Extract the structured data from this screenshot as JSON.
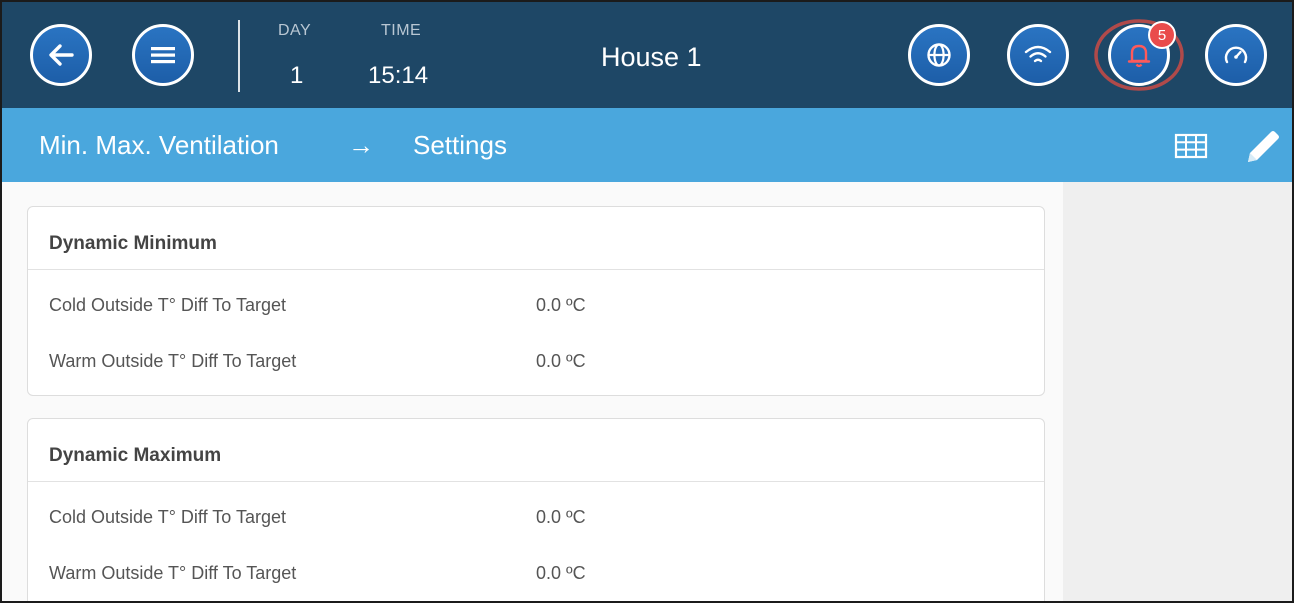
{
  "header": {
    "day_label": "DAY",
    "day_value": "1",
    "time_label": "TIME",
    "time_value": "15:14",
    "house_title": "House 1",
    "alarm_count": "5",
    "icons": [
      "back-arrow-icon",
      "menu-icon",
      "globe-icon",
      "wifi-icon",
      "bell-icon",
      "gauge-icon"
    ]
  },
  "breadcrumb": {
    "section": "Min. Max. Ventilation",
    "arrow": "→",
    "page": "Settings"
  },
  "cards": [
    {
      "title": "Dynamic Minimum",
      "rows": [
        {
          "label": "Cold Outside T° Diff To Target",
          "value": "0.0 ºC"
        },
        {
          "label": "Warm Outside T° Diff To Target",
          "value": "0.0 ºC"
        }
      ]
    },
    {
      "title": "Dynamic Maximum",
      "rows": [
        {
          "label": "Cold Outside T° Diff To Target",
          "value": "0.0 ºC"
        },
        {
          "label": "Warm Outside T° Diff To Target",
          "value": "0.0 ºC"
        }
      ]
    }
  ],
  "colors": {
    "topbar": "#1e4766",
    "crumbbar": "#4aa7dd",
    "button": "#2a74c2",
    "alarm_ring": "#b04a4a",
    "badge": "#e94b4b"
  }
}
